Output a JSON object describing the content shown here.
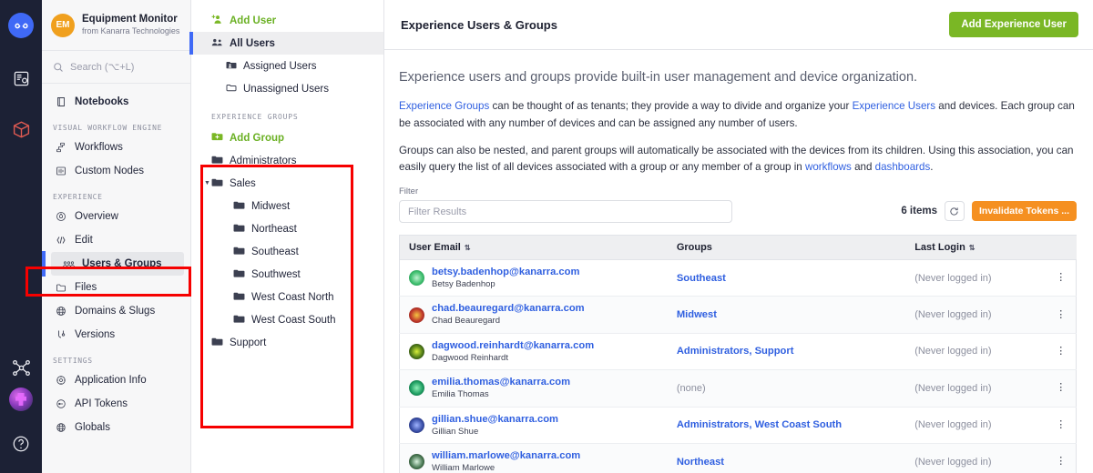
{
  "rail": {
    "logo_icon": "infinity-logo-icon",
    "items": [
      {
        "name": "notebooks-rail-icon"
      },
      {
        "name": "package-rail-icon"
      },
      {
        "name": "workflow-rail-icon"
      }
    ],
    "avatar_name": "user-avatar",
    "help_icon": "help-circle-icon"
  },
  "sidebar": {
    "app_badge": "EM",
    "app_title": "Equipment Monitor",
    "app_subtitle": "from Kanarra Technologies",
    "search_placeholder": "Search (⌥+L)",
    "notebooks_label": "Notebooks",
    "sections": [
      {
        "title": "VISUAL WORKFLOW ENGINE",
        "items": [
          {
            "label": "Workflows",
            "icon": "workflows-icon"
          },
          {
            "label": "Custom Nodes",
            "icon": "custom-nodes-icon"
          }
        ]
      },
      {
        "title": "EXPERIENCE",
        "items": [
          {
            "label": "Overview",
            "icon": "overview-icon"
          },
          {
            "label": "Edit",
            "icon": "edit-code-icon"
          },
          {
            "label": "Users & Groups",
            "icon": "users-groups-icon",
            "selected": true
          },
          {
            "label": "Files",
            "icon": "folder-icon"
          },
          {
            "label": "Domains & Slugs",
            "icon": "globe-icon"
          },
          {
            "label": "Versions",
            "icon": "branch-icon"
          }
        ]
      },
      {
        "title": "SETTINGS",
        "items": [
          {
            "label": "Application Info",
            "icon": "gear-icon"
          },
          {
            "label": "API Tokens",
            "icon": "token-icon"
          },
          {
            "label": "Globals",
            "icon": "globals-icon"
          }
        ]
      }
    ]
  },
  "panel": {
    "add_user_label": "Add User",
    "all_users_label": "All Users",
    "assigned_users_label": "Assigned Users",
    "unassigned_users_label": "Unassigned Users",
    "groups_section_title": "EXPERIENCE GROUPS",
    "add_group_label": "Add Group",
    "groups": [
      {
        "label": "Administrators",
        "indent": 0,
        "expandable": false
      },
      {
        "label": "Sales",
        "indent": 0,
        "expandable": true,
        "expanded": true
      },
      {
        "label": "Midwest",
        "indent": 1
      },
      {
        "label": "Northeast",
        "indent": 1
      },
      {
        "label": "Southeast",
        "indent": 1
      },
      {
        "label": "Southwest",
        "indent": 1
      },
      {
        "label": "West Coast North",
        "indent": 1
      },
      {
        "label": "West Coast South",
        "indent": 1
      },
      {
        "label": "Support",
        "indent": 0,
        "expandable": false
      }
    ]
  },
  "header": {
    "title": "Experience Users & Groups",
    "add_user_button": "Add Experience User"
  },
  "intro": {
    "lead": "Experience users and groups provide built-in user management and device organization.",
    "p1_link1": "Experience Groups",
    "p1_mid": " can be thought of as tenants; they provide a way to divide and organize your ",
    "p1_link2": "Experience Users",
    "p1_end": " and devices. Each group can be associated with any number of devices and can be assigned any number of users.",
    "p2_start": "Groups can also be nested, and parent groups will automatically be associated with the devices from its children. Using this association, you can easily query the list of all devices associated with a group or any member of a group in ",
    "p2_link1": "workflows",
    "p2_mid": " and ",
    "p2_link2": "dashboards",
    "p2_end": "."
  },
  "filter": {
    "label": "Filter",
    "placeholder": "Filter Results",
    "value": "",
    "items_count": "6 items",
    "refresh_icon": "refresh-icon",
    "invalidate_button": "Invalidate Tokens ..."
  },
  "table": {
    "columns": [
      "User Email",
      "Groups",
      "Last Login",
      ""
    ],
    "rows": [
      {
        "email": "betsy.badenhop@kanarra.com",
        "name": "Betsy Badenhop",
        "groups": "Southeast",
        "groups_none": false,
        "last_login": "(Never logged in)",
        "avatar_color": "#3fbf6f"
      },
      {
        "email": "chad.beauregard@kanarra.com",
        "name": "Chad Beauregard",
        "groups": "Midwest",
        "groups_none": false,
        "last_login": "(Never logged in)",
        "avatar_color": "#b02418"
      },
      {
        "email": "dagwood.reinhardt@kanarra.com",
        "name": "Dagwood Reinhardt",
        "groups": "Administrators, Support",
        "groups_none": false,
        "last_login": "(Never logged in)",
        "avatar_color": "#2b3a20"
      },
      {
        "email": "emilia.thomas@kanarra.com",
        "name": "Emilia Thomas",
        "groups": "(none)",
        "groups_none": true,
        "last_login": "(Never logged in)",
        "avatar_color": "#1f9f63"
      },
      {
        "email": "gillian.shue@kanarra.com",
        "name": "Gillian Shue",
        "groups": "Administrators, West Coast South",
        "groups_none": false,
        "last_login": "(Never logged in)",
        "avatar_color": "#2f3f8f"
      },
      {
        "email": "william.marlowe@kanarra.com",
        "name": "William Marlowe",
        "groups": "Northeast",
        "groups_none": false,
        "last_login": "(Never logged in)",
        "avatar_color": "#2a3b2e"
      }
    ],
    "kebab_glyph": "⋮"
  },
  "colors": {
    "accent_blue": "#2f5fe0",
    "green": "#7ab725",
    "orange": "#f59021",
    "rail_bg": "#1c2135",
    "annotation_red": "#f60000"
  }
}
